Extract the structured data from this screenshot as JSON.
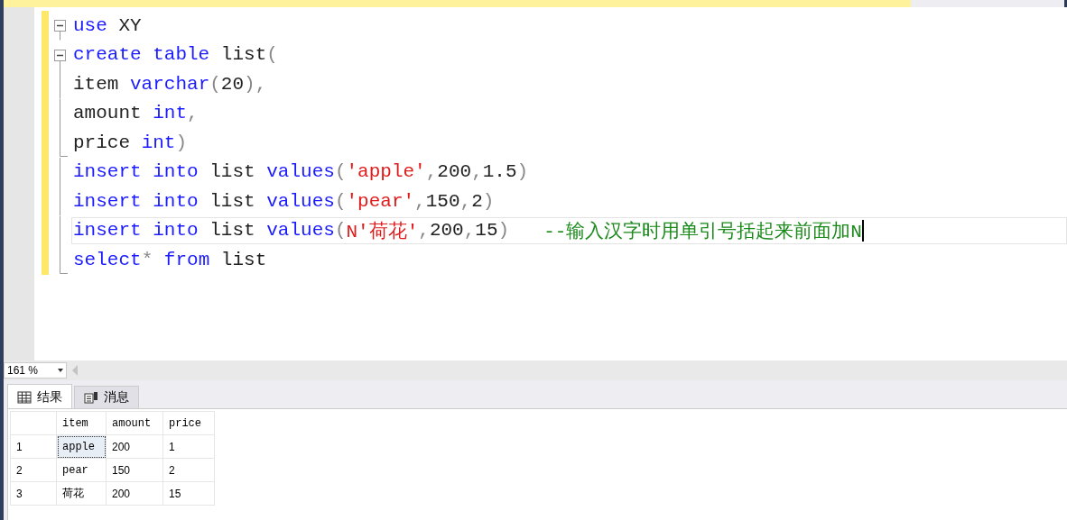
{
  "editor": {
    "lines": [
      {
        "kind": "open",
        "current": false,
        "tokens": [
          {
            "kind": "kw",
            "text": "use"
          },
          {
            "kind": "id",
            "text": " XY"
          }
        ]
      },
      {
        "kind": "open",
        "current": false,
        "tokens": [
          {
            "kind": "kw",
            "text": "create table"
          },
          {
            "kind": "id",
            "text": " list"
          },
          {
            "kind": "punct",
            "text": "("
          }
        ]
      },
      {
        "kind": "line",
        "current": false,
        "tokens": [
          {
            "kind": "id",
            "text": "item "
          },
          {
            "kind": "kw",
            "text": "varchar"
          },
          {
            "kind": "punct",
            "text": "("
          },
          {
            "kind": "id",
            "text": "20"
          },
          {
            "kind": "punct",
            "text": "),"
          }
        ]
      },
      {
        "kind": "line",
        "current": false,
        "tokens": [
          {
            "kind": "id",
            "text": "amount "
          },
          {
            "kind": "kw",
            "text": "int"
          },
          {
            "kind": "punct",
            "text": ","
          }
        ]
      },
      {
        "kind": "end",
        "current": false,
        "tokens": [
          {
            "kind": "id",
            "text": "price "
          },
          {
            "kind": "kw",
            "text": "int"
          },
          {
            "kind": "punct",
            "text": ")"
          }
        ]
      },
      {
        "kind": "line",
        "current": false,
        "tokens": [
          {
            "kind": "kw",
            "text": "insert into"
          },
          {
            "kind": "id",
            "text": " list "
          },
          {
            "kind": "kw",
            "text": "values"
          },
          {
            "kind": "punct",
            "text": "("
          },
          {
            "kind": "str",
            "text": "'apple'"
          },
          {
            "kind": "punct",
            "text": ","
          },
          {
            "kind": "id",
            "text": "200"
          },
          {
            "kind": "punct",
            "text": ","
          },
          {
            "kind": "id",
            "text": "1.5"
          },
          {
            "kind": "punct",
            "text": ")"
          }
        ]
      },
      {
        "kind": "line",
        "current": false,
        "tokens": [
          {
            "kind": "kw",
            "text": "insert into"
          },
          {
            "kind": "id",
            "text": " list "
          },
          {
            "kind": "kw",
            "text": "values"
          },
          {
            "kind": "punct",
            "text": "("
          },
          {
            "kind": "str",
            "text": "'pear'"
          },
          {
            "kind": "punct",
            "text": ","
          },
          {
            "kind": "id",
            "text": "150"
          },
          {
            "kind": "punct",
            "text": ","
          },
          {
            "kind": "id",
            "text": "2"
          },
          {
            "kind": "punct",
            "text": ")"
          }
        ]
      },
      {
        "kind": "line",
        "current": true,
        "tokens": [
          {
            "kind": "kw",
            "text": "insert into"
          },
          {
            "kind": "id",
            "text": " list "
          },
          {
            "kind": "kw",
            "text": "values"
          },
          {
            "kind": "punct",
            "text": "("
          },
          {
            "kind": "str",
            "text": "N'荷花'"
          },
          {
            "kind": "punct",
            "text": ","
          },
          {
            "kind": "id",
            "text": "200"
          },
          {
            "kind": "punct",
            "text": ","
          },
          {
            "kind": "id",
            "text": "15"
          },
          {
            "kind": "punct",
            "text": ")"
          },
          {
            "kind": "cmt",
            "text": "--输入汉字时用单引号括起来前面加N"
          }
        ]
      },
      {
        "kind": "end",
        "current": false,
        "tokens": [
          {
            "kind": "kw",
            "text": "select"
          },
          {
            "kind": "op",
            "text": "*"
          },
          {
            "kind": "kw",
            "text": " from"
          },
          {
            "kind": "id",
            "text": " list"
          }
        ]
      }
    ]
  },
  "zoom": {
    "value": "161 %"
  },
  "tabs": [
    {
      "label": "结果",
      "selected": true
    },
    {
      "label": "消息",
      "selected": false
    }
  ],
  "results": {
    "columns": [
      {
        "label": "item",
        "kind": "text"
      },
      {
        "label": "amount",
        "kind": "number"
      },
      {
        "label": "price",
        "kind": "number"
      }
    ],
    "rows": [
      {
        "number": "1",
        "selected": true,
        "cells": [
          "apple",
          "200",
          "1"
        ]
      },
      {
        "number": "2",
        "selected": false,
        "cells": [
          "pear",
          "150",
          "2"
        ]
      },
      {
        "number": "3",
        "selected": false,
        "cells": [
          "荷花",
          "200",
          "15"
        ]
      }
    ]
  }
}
